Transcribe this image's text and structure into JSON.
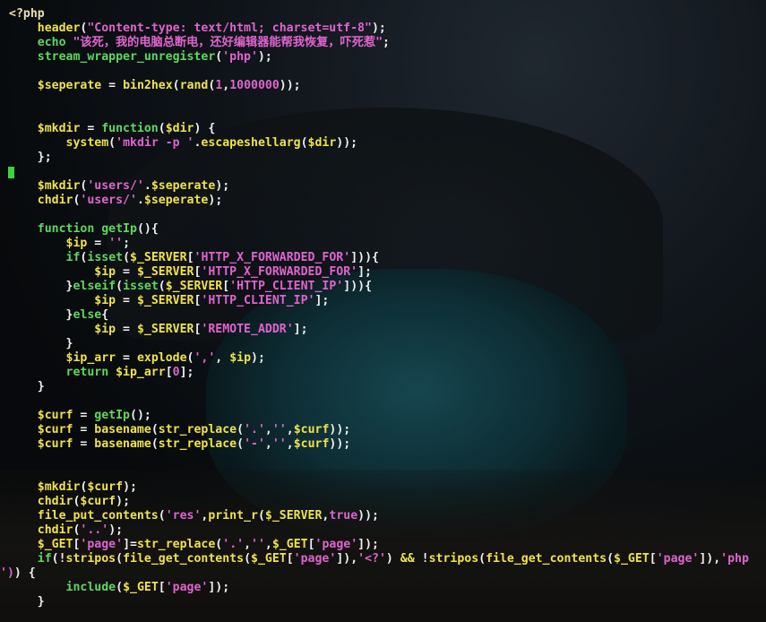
{
  "editor": {
    "lines": [
      {
        "segs": [
          [
            "p",
            "<?php"
          ]
        ]
      },
      {
        "segs": [
          [
            "w",
            "    "
          ],
          [
            "v",
            "header"
          ],
          [
            "w",
            "("
          ],
          [
            "s",
            "\"Content-type: text/html; charset=utf-8\""
          ],
          [
            "w",
            ");"
          ]
        ]
      },
      {
        "segs": [
          [
            "w",
            "    "
          ],
          [
            "k",
            "echo "
          ],
          [
            "s",
            "\"该死，我的电脑总断电，还好编辑器能帮我恢复，吓死惹\""
          ],
          [
            "w",
            ";"
          ]
        ]
      },
      {
        "segs": [
          [
            "w",
            "    "
          ],
          [
            "k",
            "stream_wrapper_unregister"
          ],
          [
            "w",
            "("
          ],
          [
            "s",
            "'php'"
          ],
          [
            "w",
            ");"
          ]
        ]
      },
      {
        "segs": []
      },
      {
        "segs": [
          [
            "w",
            "    "
          ],
          [
            "v",
            "$seperate"
          ],
          [
            "w",
            " = "
          ],
          [
            "v",
            "bin2hex"
          ],
          [
            "w",
            "("
          ],
          [
            "v",
            "rand"
          ],
          [
            "w",
            "("
          ],
          [
            "n",
            "1"
          ],
          [
            "w",
            ","
          ],
          [
            "n",
            "1000000"
          ],
          [
            "w",
            "));"
          ]
        ]
      },
      {
        "segs": []
      },
      {
        "segs": []
      },
      {
        "segs": [
          [
            "w",
            "    "
          ],
          [
            "v",
            "$mkdir"
          ],
          [
            "w",
            " = "
          ],
          [
            "k",
            "function"
          ],
          [
            "w",
            "("
          ],
          [
            "v",
            "$dir"
          ],
          [
            "w",
            ") {"
          ]
        ]
      },
      {
        "segs": [
          [
            "w",
            "        "
          ],
          [
            "v",
            "system"
          ],
          [
            "w",
            "("
          ],
          [
            "s",
            "'mkdir -p '"
          ],
          [
            "w",
            "."
          ],
          [
            "v",
            "escapeshellarg"
          ],
          [
            "w",
            "("
          ],
          [
            "v",
            "$dir"
          ],
          [
            "w",
            "));"
          ]
        ]
      },
      {
        "segs": [
          [
            "w",
            "    };"
          ]
        ]
      },
      {
        "segs": []
      },
      {
        "segs": [
          [
            "w",
            "    "
          ],
          [
            "v",
            "$mkdir"
          ],
          [
            "w",
            "("
          ],
          [
            "s",
            "'users/'"
          ],
          [
            "w",
            "."
          ],
          [
            "v",
            "$seperate"
          ],
          [
            "w",
            ");"
          ]
        ]
      },
      {
        "segs": [
          [
            "w",
            "    "
          ],
          [
            "v",
            "chdir"
          ],
          [
            "w",
            "("
          ],
          [
            "s",
            "'users/'"
          ],
          [
            "w",
            "."
          ],
          [
            "v",
            "$seperate"
          ],
          [
            "w",
            ");"
          ]
        ]
      },
      {
        "segs": []
      },
      {
        "segs": [
          [
            "w",
            "    "
          ],
          [
            "k",
            "function "
          ],
          [
            "k",
            "getIp"
          ],
          [
            "w",
            "(){"
          ]
        ]
      },
      {
        "segs": [
          [
            "w",
            "        "
          ],
          [
            "v",
            "$ip"
          ],
          [
            "w",
            " = "
          ],
          [
            "s",
            "''"
          ],
          [
            "w",
            ";"
          ]
        ]
      },
      {
        "segs": [
          [
            "w",
            "        "
          ],
          [
            "k",
            "if"
          ],
          [
            "w",
            "("
          ],
          [
            "k",
            "isset"
          ],
          [
            "w",
            "("
          ],
          [
            "v",
            "$_SERVER"
          ],
          [
            "w",
            "["
          ],
          [
            "s",
            "'HTTP_X_FORWARDED_FOR'"
          ],
          [
            "w",
            "])){"
          ]
        ]
      },
      {
        "segs": [
          [
            "w",
            "            "
          ],
          [
            "v",
            "$ip"
          ],
          [
            "w",
            " = "
          ],
          [
            "v",
            "$_SERVER"
          ],
          [
            "w",
            "["
          ],
          [
            "s",
            "'HTTP_X_FORWARDED_FOR'"
          ],
          [
            "w",
            "];"
          ]
        ]
      },
      {
        "segs": [
          [
            "w",
            "        }"
          ],
          [
            "k",
            "elseif"
          ],
          [
            "w",
            "("
          ],
          [
            "k",
            "isset"
          ],
          [
            "w",
            "("
          ],
          [
            "v",
            "$_SERVER"
          ],
          [
            "w",
            "["
          ],
          [
            "s",
            "'HTTP_CLIENT_IP'"
          ],
          [
            "w",
            "])){"
          ]
        ]
      },
      {
        "segs": [
          [
            "w",
            "            "
          ],
          [
            "v",
            "$ip"
          ],
          [
            "w",
            " = "
          ],
          [
            "v",
            "$_SERVER"
          ],
          [
            "w",
            "["
          ],
          [
            "s",
            "'HTTP_CLIENT_IP'"
          ],
          [
            "w",
            "];"
          ]
        ]
      },
      {
        "segs": [
          [
            "w",
            "        }"
          ],
          [
            "k",
            "else"
          ],
          [
            "w",
            "{"
          ]
        ]
      },
      {
        "segs": [
          [
            "w",
            "            "
          ],
          [
            "v",
            "$ip"
          ],
          [
            "w",
            " = "
          ],
          [
            "v",
            "$_SERVER"
          ],
          [
            "w",
            "["
          ],
          [
            "s",
            "'REMOTE_ADDR'"
          ],
          [
            "w",
            "];"
          ]
        ]
      },
      {
        "segs": [
          [
            "w",
            "        }"
          ]
        ]
      },
      {
        "segs": [
          [
            "w",
            "        "
          ],
          [
            "v",
            "$ip_arr"
          ],
          [
            "w",
            " = "
          ],
          [
            "v",
            "explode"
          ],
          [
            "w",
            "("
          ],
          [
            "s",
            "','"
          ],
          [
            "w",
            ", "
          ],
          [
            "v",
            "$ip"
          ],
          [
            "w",
            ");"
          ]
        ]
      },
      {
        "segs": [
          [
            "w",
            "        "
          ],
          [
            "k",
            "return "
          ],
          [
            "v",
            "$ip_arr"
          ],
          [
            "w",
            "["
          ],
          [
            "n",
            "0"
          ],
          [
            "w",
            "];"
          ]
        ]
      },
      {
        "segs": [
          [
            "w",
            "    }"
          ]
        ]
      },
      {
        "segs": []
      },
      {
        "segs": [
          [
            "w",
            "    "
          ],
          [
            "v",
            "$curf"
          ],
          [
            "w",
            " = "
          ],
          [
            "k",
            "getIp"
          ],
          [
            "w",
            "();"
          ]
        ]
      },
      {
        "segs": [
          [
            "w",
            "    "
          ],
          [
            "v",
            "$curf"
          ],
          [
            "w",
            " = "
          ],
          [
            "v",
            "basename"
          ],
          [
            "w",
            "("
          ],
          [
            "v",
            "str_replace"
          ],
          [
            "w",
            "("
          ],
          [
            "s",
            "'.'"
          ],
          [
            "w",
            ","
          ],
          [
            "s",
            "''"
          ],
          [
            "w",
            ","
          ],
          [
            "v",
            "$curf"
          ],
          [
            "w",
            "));"
          ]
        ]
      },
      {
        "segs": [
          [
            "w",
            "    "
          ],
          [
            "v",
            "$curf"
          ],
          [
            "w",
            " = "
          ],
          [
            "v",
            "basename"
          ],
          [
            "w",
            "("
          ],
          [
            "v",
            "str_replace"
          ],
          [
            "w",
            "("
          ],
          [
            "s",
            "'-'"
          ],
          [
            "w",
            ","
          ],
          [
            "s",
            "''"
          ],
          [
            "w",
            ","
          ],
          [
            "v",
            "$curf"
          ],
          [
            "w",
            "));"
          ]
        ]
      },
      {
        "segs": []
      },
      {
        "segs": []
      },
      {
        "segs": [
          [
            "w",
            "    "
          ],
          [
            "v",
            "$mkdir"
          ],
          [
            "w",
            "("
          ],
          [
            "v",
            "$curf"
          ],
          [
            "w",
            ");"
          ]
        ]
      },
      {
        "segs": [
          [
            "w",
            "    "
          ],
          [
            "v",
            "chdir"
          ],
          [
            "w",
            "("
          ],
          [
            "v",
            "$curf"
          ],
          [
            "w",
            ");"
          ]
        ]
      },
      {
        "segs": [
          [
            "w",
            "    "
          ],
          [
            "v",
            "file_put_contents"
          ],
          [
            "w",
            "("
          ],
          [
            "s",
            "'res'"
          ],
          [
            "w",
            ","
          ],
          [
            "v",
            "print_r"
          ],
          [
            "w",
            "("
          ],
          [
            "v",
            "$_SERVER"
          ],
          [
            "w",
            ","
          ],
          [
            "n",
            "true"
          ],
          [
            "w",
            "));"
          ]
        ]
      },
      {
        "segs": [
          [
            "w",
            "    "
          ],
          [
            "v",
            "chdir"
          ],
          [
            "w",
            "("
          ],
          [
            "s",
            "'..'"
          ],
          [
            "w",
            ");"
          ]
        ]
      },
      {
        "segs": [
          [
            "w",
            "    "
          ],
          [
            "v",
            "$_GET"
          ],
          [
            "w",
            "["
          ],
          [
            "s",
            "'page'"
          ],
          [
            "w",
            "]="
          ],
          [
            "v",
            "str_replace"
          ],
          [
            "w",
            "("
          ],
          [
            "s",
            "'.'"
          ],
          [
            "w",
            ","
          ],
          [
            "s",
            "''"
          ],
          [
            "w",
            ","
          ],
          [
            "v",
            "$_GET"
          ],
          [
            "w",
            "["
          ],
          [
            "s",
            "'page'"
          ],
          [
            "w",
            "]);"
          ]
        ]
      },
      {
        "segs": [
          [
            "w",
            "    "
          ],
          [
            "k",
            "if"
          ],
          [
            "w",
            "(!"
          ],
          [
            "v",
            "stripos"
          ],
          [
            "w",
            "("
          ],
          [
            "v",
            "file_get_contents"
          ],
          [
            "w",
            "("
          ],
          [
            "v",
            "$_GET"
          ],
          [
            "w",
            "["
          ],
          [
            "s",
            "'page'"
          ],
          [
            "w",
            "]),"
          ],
          [
            "s",
            "'<?'"
          ],
          [
            "w",
            ") "
          ],
          [
            "v",
            "&&"
          ],
          [
            "w",
            " !"
          ],
          [
            "v",
            "stripos"
          ],
          [
            "w",
            "("
          ],
          [
            "v",
            "file_get_contents"
          ],
          [
            "w",
            "("
          ],
          [
            "v",
            "$_GET"
          ],
          [
            "w",
            "["
          ],
          [
            "s",
            "'page'"
          ],
          [
            "w",
            "]),"
          ],
          [
            "s",
            "'php"
          ]
        ]
      },
      {
        "segs": [
          [
            "s",
            "')"
          ],
          [
            "w",
            ") {"
          ]
        ]
      },
      {
        "segs": [
          [
            "w",
            "        "
          ],
          [
            "k",
            "include"
          ],
          [
            "w",
            "("
          ],
          [
            "v",
            "$_GET"
          ],
          [
            "w",
            "["
          ],
          [
            "s",
            "'page'"
          ],
          [
            "w",
            "]);"
          ]
        ]
      },
      {
        "segs": [
          [
            "w",
            "    }"
          ]
        ]
      }
    ]
  }
}
